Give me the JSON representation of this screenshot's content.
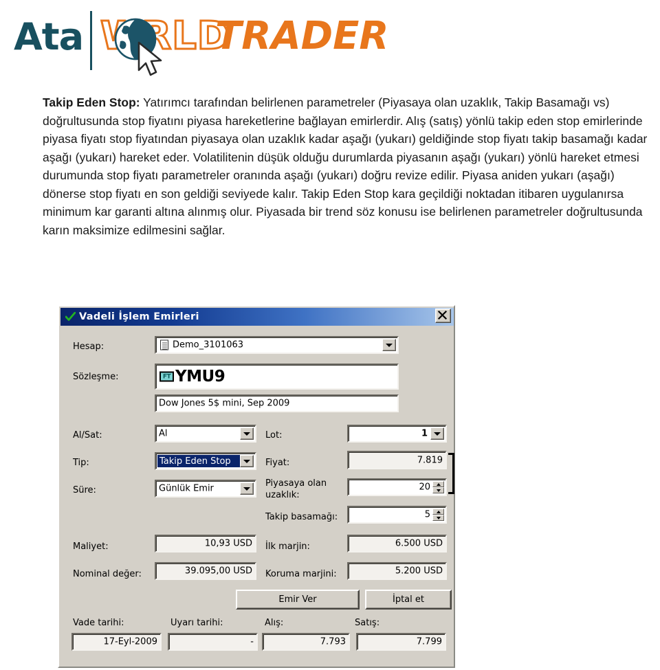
{
  "logo": {
    "brand_first": "Ata",
    "word_w": "W",
    "word_rld": "RLD",
    "word_trader": "TRADER",
    "teal": "#18505f",
    "orange": "#e8761c",
    "globe_icon": "globe-icon",
    "cursor_icon": "mouse-cursor-icon"
  },
  "paragraph": {
    "heading": "Takip Eden Stop:",
    "body": " Yatırımcı tarafından belirlenen parametreler (Piyasaya olan uzaklık,  Takip Basamağı vs) doğrultusunda stop fiyatını piyasa hareketlerine bağlayan emirlerdir. Alış (satış) yönlü takip eden stop emirlerinde piyasa fiyatı stop fiyatından piyasaya olan uzaklık kadar aşağı (yukarı) geldiğinde stop fiyatı takip basamağı kadar aşağı (yukarı) hareket eder. Volatilitenin düşük olduğu durumlarda piyasanın aşağı (yukarı) yönlü hareket etmesi durumunda stop fiyatı parametreler oranında aşağı (yukarı) doğru revize edilir. Piyasa aniden yukarı (aşağı) dönerse stop fiyatı en son geldiği seviyede kalır. Takip Eden Stop kara geçildiği noktadan itibaren uygulanırsa minimum kar garanti altına alınmış olur. Piyasada bir trend söz konusu ise belirlenen parametreler doğrultusunda karın maksimize edilmesini sağlar."
  },
  "dialog": {
    "title": "Vadeli İşlem Emirleri",
    "title_check_icon": "green-check-icon",
    "close_icon": "close-icon",
    "close_label": "✕",
    "titlebar_color": "#0a246a",
    "face_color": "#d4d0c8",
    "fields": {
      "hesap_label": "Hesap:",
      "hesap_value": "Demo_3101063",
      "hesap_icon": "document-icon",
      "sozlesme_label": "Sözleşme:",
      "sozlesme_value": "YMU9",
      "sozlesme_badge": "FT",
      "sozlesme_desc": "Dow Jones 5$ mini, Sep 2009",
      "alsat_label": "Al/Sat:",
      "alsat_value": "Al",
      "lot_label": "Lot:",
      "lot_value": "1",
      "tip_label": "Tip:",
      "tip_value": "Takip Eden Stop",
      "fiyat_label": "Fiyat:",
      "fiyat_value": "7.819",
      "sure_label": "Süre:",
      "sure_value": "Günlük Emir",
      "uzaklik_label_l1": "Piyasaya olan",
      "uzaklik_label_l2": "uzaklık:",
      "uzaklik_value": "20",
      "basamak_label": "Takip basamağı:",
      "basamak_value": "5",
      "maliyet_label": "Maliyet:",
      "maliyet_value": "10,93 USD",
      "ilk_marjin_label": "İlk marjin:",
      "ilk_marjin_value": "6.500 USD",
      "nominal_label": "Nominal değer:",
      "nominal_value": "39.095,00 USD",
      "koruma_label": "Koruma marjini:",
      "koruma_value": "5.200 USD",
      "vade_label": "Vade tarihi:",
      "vade_value": "17-Eyl-2009",
      "uyari_label": "Uyarı tarihi:",
      "uyari_value": "-",
      "alis_label": "Alış:",
      "alis_value": "7.793",
      "satis_label": "Satış:",
      "satis_value": "7.799"
    },
    "buttons": {
      "submit": "Emir Ver",
      "cancel": "İptal et"
    }
  }
}
